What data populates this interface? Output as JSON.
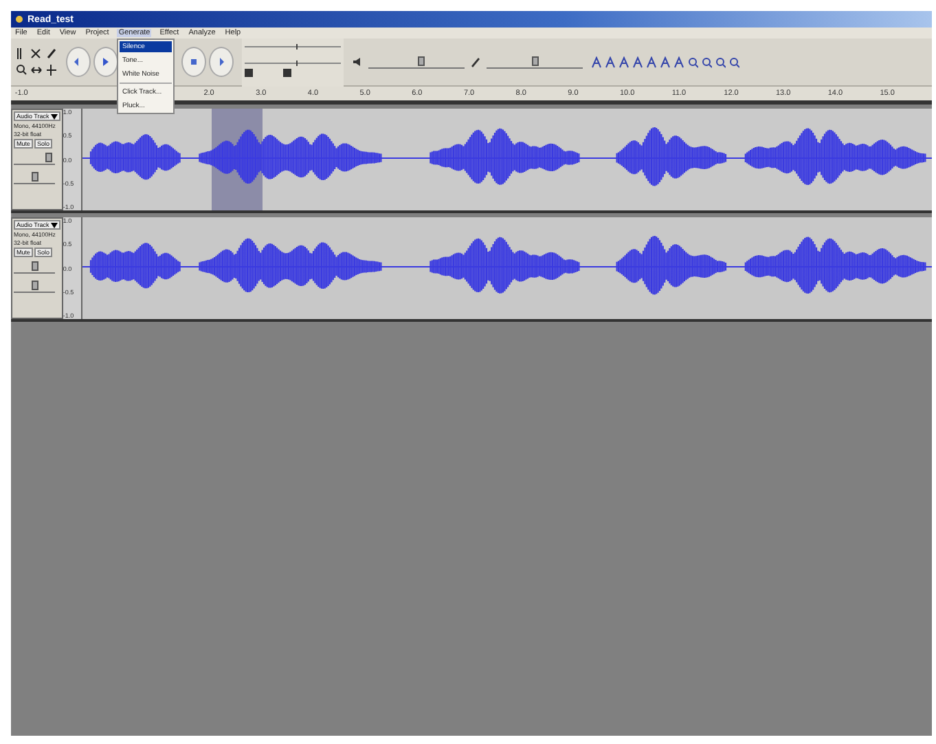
{
  "window": {
    "title": "Read_test"
  },
  "menu_bar": [
    {
      "label": "File",
      "selected": false
    },
    {
      "label": "Edit",
      "selected": false
    },
    {
      "label": "View",
      "selected": false
    },
    {
      "label": "Project",
      "selected": false
    },
    {
      "label": "Generate",
      "selected": true
    },
    {
      "label": "Effect",
      "selected": false
    },
    {
      "label": "Analyze",
      "selected": false
    },
    {
      "label": "Help",
      "selected": false
    }
  ],
  "open_menu": {
    "items": [
      {
        "label": "Silence",
        "selected": true
      },
      {
        "label": "Tone...",
        "selected": false
      },
      {
        "label": "White Noise",
        "selected": false
      },
      {
        "label": "Click Track...",
        "selected": false
      },
      {
        "label": "Pluck...",
        "selected": false
      }
    ]
  },
  "mixer": {
    "output": {
      "level": 0.55
    },
    "input": {
      "level": 0.5
    }
  },
  "ruler": [
    "-1.0",
    "2.0",
    "3.0",
    "4.0",
    "5.0",
    "6.0",
    "7.0",
    "8.0",
    "9.0",
    "10.0",
    "11.0",
    "12.0",
    "13.0",
    "14.0",
    "15.0"
  ],
  "tracks": [
    {
      "name": "Audio Track",
      "info": [
        "Mono, 44100Hz",
        "32-bit float"
      ],
      "buttons": [
        "Mute",
        "Solo"
      ],
      "gain": {
        "level": 0.9
      },
      "pan": {
        "level": 0.5
      },
      "selected": true,
      "scale": [
        "1.0",
        "0.5",
        "0.0",
        "-0.5",
        "-1.0"
      ]
    },
    {
      "name": "Audio Track",
      "info": [
        "Mono, 44100Hz",
        "32-bit float"
      ],
      "buttons": [
        "Mute",
        "Solo"
      ],
      "gain": {
        "level": 0.5
      },
      "pan": {
        "level": 0.5
      },
      "selected": false,
      "scale": [
        "1.0",
        "0.5",
        "0.0",
        "-0.5",
        "-1.0"
      ]
    }
  ]
}
